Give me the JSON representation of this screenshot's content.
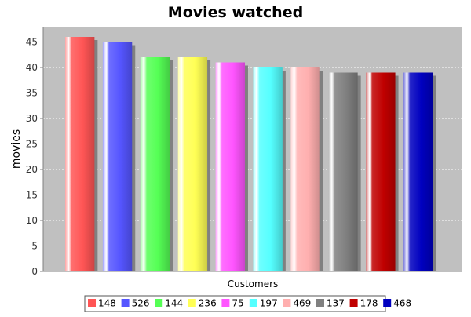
{
  "chart_data": {
    "type": "bar",
    "title": "Movies watched",
    "xlabel": "Customers",
    "ylabel": "movies",
    "ylim": [
      0,
      48
    ],
    "yticks": [
      0,
      5,
      10,
      15,
      20,
      25,
      30,
      35,
      40,
      45
    ],
    "grid": true,
    "legend_position": "bottom",
    "plot_background": "#c0c0c0",
    "series": [
      {
        "name": "148",
        "value": 46,
        "color": "#ff5555"
      },
      {
        "name": "526",
        "value": 45,
        "color": "#5555ff"
      },
      {
        "name": "144",
        "value": 42,
        "color": "#55ff55"
      },
      {
        "name": "236",
        "value": 42,
        "color": "#ffff55"
      },
      {
        "name": "75",
        "value": 41,
        "color": "#ff55ff"
      },
      {
        "name": "197",
        "value": 40,
        "color": "#55ffff"
      },
      {
        "name": "469",
        "value": 40,
        "color": "#ffafaf"
      },
      {
        "name": "137",
        "value": 39,
        "color": "#808080"
      },
      {
        "name": "178",
        "value": 39,
        "color": "#c00000"
      },
      {
        "name": "468",
        "value": 39,
        "color": "#0000c0"
      }
    ]
  }
}
